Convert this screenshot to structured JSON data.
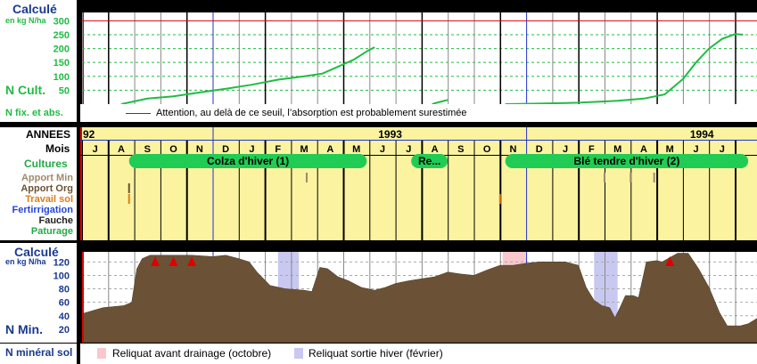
{
  "top_panel": {
    "title": "Calculé",
    "unit": "en kg N/ha",
    "series_label": "N Cult.",
    "legend_row_label": "N fix. et abs.",
    "threshold_note": "Attention, au delà de ce seuil, l’absorption est probablement surestimée",
    "colors": {
      "threshold": "#e00000",
      "curve": "#22bb44",
      "label": "#22bb44",
      "title": "#1a3a8f"
    }
  },
  "timeline": {
    "years_label": "ANNEES",
    "years": [
      "92",
      "1993",
      "1994"
    ],
    "months_label": "Mois",
    "months": [
      "J",
      "A",
      "S",
      "O",
      "N",
      "D",
      "J",
      "F",
      "M",
      "A",
      "M",
      "J",
      "J",
      "A",
      "S",
      "O",
      "N",
      "D",
      "J",
      "F",
      "M",
      "A",
      "M",
      "J",
      "J"
    ],
    "crops_label": "Cultures",
    "crops": [
      {
        "label": "Colza d'hiver (1)"
      },
      {
        "label": "Re..."
      },
      {
        "label": "Blé tendre d'hiver (2)"
      }
    ],
    "operations": [
      {
        "label": "Apport Min",
        "color": "#a08a6a"
      },
      {
        "label": "Apport Org",
        "color": "#6b5236"
      },
      {
        "label": "Travail sol",
        "color": "#e07c1a"
      },
      {
        "label": "Fertirrigation",
        "color": "#2244dd"
      },
      {
        "label": "Fauche",
        "color": "#222222"
      },
      {
        "label": "Paturage",
        "color": "#22aa44"
      }
    ],
    "colors": {
      "background": "#fbf3a0",
      "crop": "#21cc55",
      "year_line": "#2233cc"
    }
  },
  "bottom_panel": {
    "title": "Calculé",
    "unit": "en kg N/ha",
    "series_label": "N Min.",
    "legend_row_label": "N minéral sol",
    "legend": [
      {
        "label": "Reliquat avant drainage (octobre)",
        "color": "#f8c8cc"
      },
      {
        "label": "Reliquat sortie hiver (février)",
        "color": "#c8c8f0"
      }
    ],
    "colors": {
      "area": "#6b5236",
      "label": "#1a3a8f",
      "marker": "#e00000",
      "plot_bg": "#ffffff"
    }
  },
  "chart_data": [
    {
      "type": "line",
      "title": "Calculé",
      "ylabel": "en kg N/ha",
      "series_name": "N Cult.",
      "x_unit": "months since July 1992",
      "ylim": [
        0,
        330
      ],
      "yticks": [
        50,
        100,
        150,
        200,
        250,
        300
      ],
      "threshold": 300,
      "series": [
        {
          "name": "Colza d'hiver (1)",
          "points": [
            [
              1.5,
              0
            ],
            [
              2.5,
              20
            ],
            [
              3.5,
              28
            ],
            [
              4.5,
              42
            ],
            [
              5.5,
              55
            ],
            [
              6.5,
              70
            ],
            [
              7.5,
              88
            ],
            [
              8.5,
              100
            ],
            [
              9.2,
              110
            ],
            [
              9.8,
              135
            ],
            [
              10.4,
              160
            ],
            [
              10.9,
              190
            ],
            [
              11.2,
              205
            ]
          ]
        },
        {
          "name": "Re...",
          "points": [
            [
              13.4,
              0
            ],
            [
              13.7,
              8
            ],
            [
              14.0,
              15
            ]
          ]
        },
        {
          "name": "Blé tendre d'hiver (2)",
          "points": [
            [
              16.2,
              0
            ],
            [
              17.5,
              2
            ],
            [
              19.0,
              5
            ],
            [
              20.5,
              12
            ],
            [
              21.5,
              20
            ],
            [
              22.3,
              35
            ],
            [
              23.0,
              90
            ],
            [
              23.5,
              150
            ],
            [
              24.0,
              200
            ],
            [
              24.5,
              235
            ],
            [
              25.0,
              252
            ],
            [
              25.3,
              250
            ]
          ]
        }
      ]
    },
    {
      "type": "area",
      "title": "Calculé",
      "ylabel": "en kg N/ha",
      "series_name": "N Min.",
      "x_unit": "months since July 1992",
      "ylim": [
        0,
        135
      ],
      "yticks": [
        20,
        40,
        60,
        80,
        100,
        120
      ],
      "points": [
        [
          0,
          43
        ],
        [
          0.8,
          52
        ],
        [
          1.6,
          55
        ],
        [
          1.9,
          60
        ],
        [
          2.1,
          110
        ],
        [
          2.3,
          125
        ],
        [
          2.6,
          130
        ],
        [
          3.4,
          130
        ],
        [
          4.2,
          130
        ],
        [
          5.0,
          128
        ],
        [
          5.5,
          130
        ],
        [
          6.0,
          125
        ],
        [
          6.4,
          120
        ],
        [
          6.7,
          105
        ],
        [
          7.2,
          85
        ],
        [
          7.8,
          80
        ],
        [
          8.5,
          78
        ],
        [
          8.8,
          76
        ],
        [
          9.1,
          112
        ],
        [
          9.4,
          110
        ],
        [
          9.8,
          98
        ],
        [
          10.2,
          92
        ],
        [
          10.7,
          82
        ],
        [
          11.2,
          78
        ],
        [
          11.6,
          82
        ],
        [
          12.0,
          88
        ],
        [
          12.5,
          92
        ],
        [
          13.0,
          95
        ],
        [
          13.5,
          98
        ],
        [
          14.0,
          105
        ],
        [
          14.5,
          102
        ],
        [
          15.0,
          100
        ],
        [
          15.5,
          108
        ],
        [
          16.0,
          115
        ],
        [
          16.5,
          115
        ],
        [
          17.0,
          118
        ],
        [
          17.5,
          120
        ],
        [
          18.0,
          120
        ],
        [
          18.5,
          120
        ],
        [
          19.0,
          115
        ],
        [
          19.3,
          82
        ],
        [
          19.6,
          63
        ],
        [
          19.9,
          55
        ],
        [
          20.2,
          52
        ],
        [
          20.4,
          37
        ],
        [
          20.6,
          53
        ],
        [
          20.8,
          70
        ],
        [
          21.1,
          70
        ],
        [
          21.3,
          67
        ],
        [
          21.6,
          120
        ],
        [
          22.0,
          122
        ],
        [
          22.2,
          120
        ],
        [
          22.8,
          133
        ],
        [
          23.2,
          133
        ],
        [
          23.6,
          110
        ],
        [
          24.0,
          82
        ],
        [
          24.4,
          45
        ],
        [
          24.7,
          25
        ],
        [
          25.2,
          25
        ],
        [
          25.5,
          28
        ],
        [
          26.0,
          40
        ]
      ],
      "markers_x": [
        2.8,
        3.5,
        4.2,
        22.5
      ],
      "spans": [
        {
          "kind": "Reliquat avant drainage (octobre)",
          "x": [
            16.1,
            17.0
          ]
        },
        {
          "kind": "Reliquat sortie hiver (février)",
          "x": [
            7.5,
            8.3
          ]
        },
        {
          "kind": "Reliquat sortie hiver (février)",
          "x": [
            19.6,
            20.5
          ]
        }
      ]
    }
  ]
}
